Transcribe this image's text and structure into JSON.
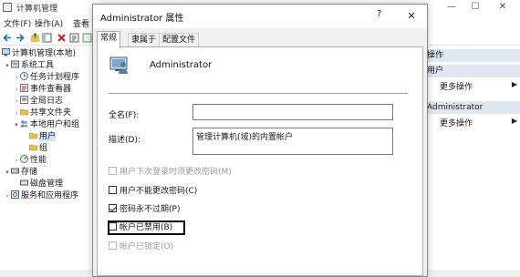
{
  "bg": {
    "title": "计算机管理",
    "menu": [
      "文件(F)",
      "操作(A)",
      "查看"
    ],
    "tree": [
      {
        "label": "计算机管理(本地)",
        "indent": 0,
        "arrow": "",
        "icon": "computer"
      },
      {
        "label": "系统工具",
        "indent": 1,
        "arrow": "▾",
        "icon": "tools"
      },
      {
        "label": "任务计划程序",
        "indent": 2,
        "arrow": "›",
        "icon": "clock"
      },
      {
        "label": "事件查看器",
        "indent": 2,
        "arrow": "›",
        "icon": "log"
      },
      {
        "label": "全局日志",
        "indent": 2,
        "arrow": "›",
        "icon": "log"
      },
      {
        "label": "共享文件夹",
        "indent": 2,
        "arrow": "›",
        "icon": "folder"
      },
      {
        "label": "本地用户和组",
        "indent": 2,
        "arrow": "▾",
        "icon": "users"
      },
      {
        "label": "用户",
        "indent": 3,
        "arrow": "",
        "icon": "folder",
        "selected": true
      },
      {
        "label": "组",
        "indent": 3,
        "arrow": "",
        "icon": "folder"
      },
      {
        "label": "性能",
        "indent": 2,
        "arrow": "›",
        "icon": "perf"
      },
      {
        "label": "存储",
        "indent": 1,
        "arrow": "▾",
        "icon": "storage"
      },
      {
        "label": "磁盘管理",
        "indent": 2,
        "arrow": "",
        "icon": "disk"
      },
      {
        "label": "服务和应用程序",
        "indent": 1,
        "arrow": "›",
        "icon": "services"
      }
    ],
    "actions": {
      "header1": "操作",
      "header2": "用户",
      "more1": "更多操作",
      "header3": "Administrator",
      "more2": "更多操作"
    }
  },
  "dialog": {
    "title": "Administrator 属性",
    "help": "?",
    "close": "✕",
    "tabs": [
      "常规",
      "隶属于",
      "配置文件"
    ],
    "user_name": "Administrator",
    "fullname_label": "全名(F):",
    "fullname_value": "",
    "desc_label": "描述(D):",
    "desc_value": "管理计算机(域)的内置帐户",
    "checks": [
      {
        "label": "用户下次登录时须更改密码(M)",
        "checked": false,
        "disabled": true
      },
      {
        "label": "用户不能更改密码(C)",
        "checked": false,
        "disabled": false
      },
      {
        "label": "密码永不过期(P)",
        "checked": true,
        "disabled": false
      },
      {
        "label": "帐户已禁用(B)",
        "checked": false,
        "disabled": false
      },
      {
        "label": "帐户已锁定(O)",
        "checked": false,
        "disabled": true
      }
    ]
  },
  "colors": {
    "selected": "#cce4f7",
    "actions_header": "#dfe8f1",
    "dialog_bg": "#f0f0f0"
  }
}
